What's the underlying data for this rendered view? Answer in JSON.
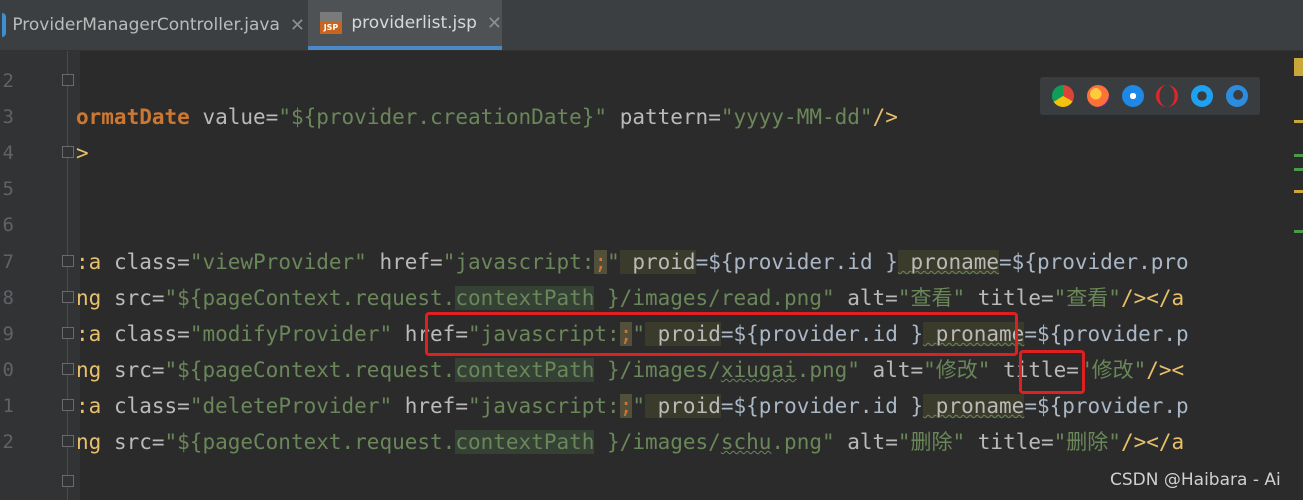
{
  "tabs": [
    {
      "label": "ProviderManagerController.java",
      "icon": "java-class-icon",
      "close": "✕",
      "active": false
    },
    {
      "label": "providerlist.jsp",
      "icon": "jsp-file-icon",
      "badge": "JSP",
      "close": "✕",
      "active": true
    }
  ],
  "line_numbers": [
    "2",
    "3",
    "4",
    "5",
    "6",
    "7",
    "8",
    "9",
    "0",
    "1",
    "2"
  ],
  "code": {
    "l3": {
      "a": "ormatDate",
      "b": " value=",
      "c": "\"${provider.creationDate}\"",
      "d": " pattern=",
      "e": "\"yyyy-MM-dd\"",
      "f": "/>"
    },
    "l4": {
      "a": ">"
    },
    "l7": {
      "a": ":a",
      "b": " class=",
      "c": "\"viewProvider\"",
      "d": " href=",
      "e": "\"javascript:",
      "f": ";",
      "g": "\"",
      "h": " proid",
      "i": "=${provider.id }",
      "j": " proname",
      "k": "=${provider.pro"
    },
    "l8": {
      "a": "ng",
      "b": " src=",
      "c": "\"${pageContext.request.",
      "d": "contextPath",
      "e": " }/images/read.png\"",
      "f": " alt=",
      "g": "\"查看\"",
      "h": " title=",
      "i": "\"查看\"",
      "j": "/></a"
    },
    "l9": {
      "a": ":a",
      "b": " class=",
      "c": "\"modifyProvider\"",
      "d": " href=",
      "e": "\"javascript:",
      "f": ";",
      "g": "\"",
      "h": " proid",
      "i": "=${provider.id }",
      "j": " proname",
      "k": "=${provider.p"
    },
    "l10": {
      "a": "ng",
      "b": " src=",
      "c": "\"${pageContext.request.",
      "d": "contextPath",
      "e": " }/images/",
      "f": "xiugai",
      "g": ".png\"",
      "h": " alt=",
      "i": "\"修改\"",
      "j": " title=",
      "k": "\"修改\"",
      "l": "/><"
    },
    "l11": {
      "a": ":a",
      "b": " class=",
      "c": "\"deleteProvider\"",
      "d": " href=",
      "e": "\"javascript:",
      "f": ";",
      "g": "\"",
      "h": " proid",
      "i": "=${provider.id }",
      "j": " proname",
      "k": "=${provider.p"
    },
    "l12": {
      "a": "ng",
      "b": " src=",
      "c": "\"${pageContext.request.",
      "d": "contextPath",
      "e": " }/images/",
      "f": "schu",
      "g": ".png\"",
      "h": " alt=",
      "i": "\"删除\"",
      "j": " title=",
      "k": "\"删除\"",
      "l": "/></a"
    }
  },
  "browser_icons": [
    "chrome-icon",
    "firefox-icon",
    "safari-icon",
    "opera-icon",
    "ie-icon",
    "edge-icon"
  ],
  "colors": {
    "highlight_box": "#e02020",
    "active_tab_underline": "#4a88c7"
  },
  "watermark": "CSDN @Haibara - Ai"
}
